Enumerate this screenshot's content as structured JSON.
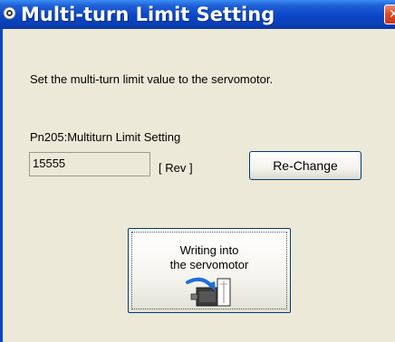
{
  "window": {
    "title": "Multi-turn Limit Setting"
  },
  "main": {
    "description": "Set the multi-turn limit value to the servomotor.",
    "parameter_label": "Pn205:Multiturn Limit Setting",
    "value": "15555",
    "unit": "[ Rev ]",
    "rechange_label": "Re-Change",
    "write_button": {
      "line1": "Writing into",
      "line2": "the servomotor"
    }
  },
  "icons": {
    "app": "app-icon",
    "close": "close-icon",
    "servo": "servomotor-icon"
  },
  "colors": {
    "titlebar": "#0a46c6",
    "window_background": "#ece9d8",
    "close_button": "#dd4a24",
    "arrow": "#1f6fd6"
  }
}
